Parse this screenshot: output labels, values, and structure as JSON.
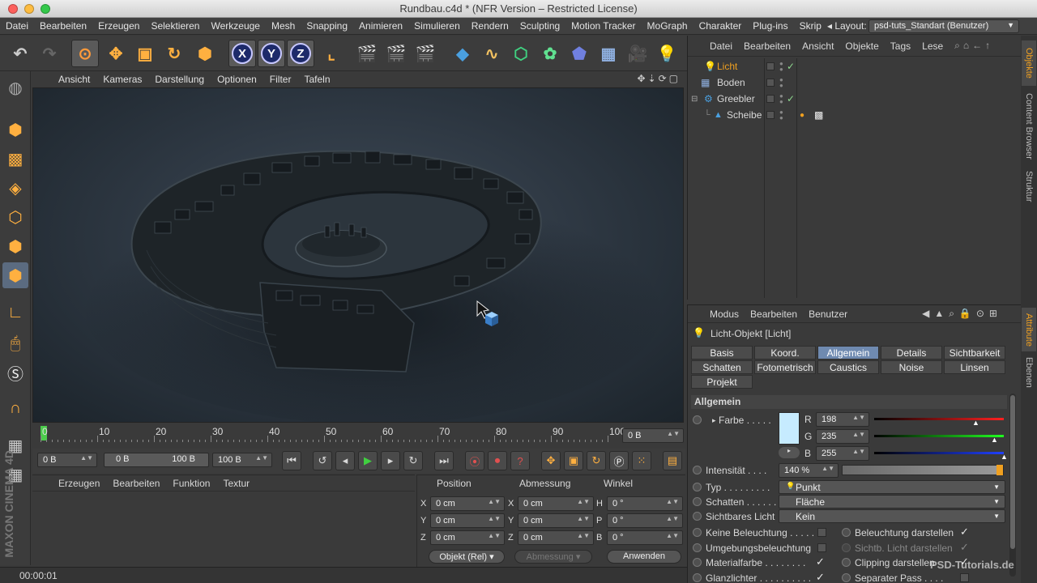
{
  "window": {
    "title": "Rundbau.c4d * (NFR Version – Restricted License)"
  },
  "menubar": {
    "items": [
      "Datei",
      "Bearbeiten",
      "Erzeugen",
      "Selektieren",
      "Werkzeuge",
      "Mesh",
      "Snapping",
      "Animieren",
      "Simulieren",
      "Rendern",
      "Sculpting",
      "Motion Tracker",
      "MoGraph",
      "Charakter",
      "Plug-ins",
      "Skrip"
    ],
    "layout_label": "Layout:",
    "layout_value": "psd-tuts_Standart (Benutzer)"
  },
  "toolbar": {
    "axis_x": "X",
    "axis_y": "Y",
    "axis_z": "Z"
  },
  "viewport": {
    "menu": [
      "Ansicht",
      "Kameras",
      "Darstellung",
      "Optionen",
      "Filter",
      "Tafeln"
    ]
  },
  "timeline": {
    "ticks": [
      "0",
      "10",
      "20",
      "30",
      "40",
      "50",
      "60",
      "70",
      "80",
      "90",
      "100"
    ],
    "current_frame": "0 B",
    "start_field": "0 B",
    "min_field": "0 B",
    "max_field": "100 B",
    "end_field": "100 B"
  },
  "material_manager": {
    "menu": [
      "Erzeugen",
      "Bearbeiten",
      "Funktion",
      "Textur"
    ]
  },
  "coordinates": {
    "headers": [
      "Position",
      "Abmessung",
      "Winkel"
    ],
    "rows": [
      {
        "pos_axis": "X",
        "pos": "0 cm",
        "size_axis": "X",
        "size": "0 cm",
        "rot_axis": "H",
        "rot": "0 °"
      },
      {
        "pos_axis": "Y",
        "pos": "0 cm",
        "size_axis": "Y",
        "size": "0 cm",
        "rot_axis": "P",
        "rot": "0 °"
      },
      {
        "pos_axis": "Z",
        "pos": "0 cm",
        "size_axis": "Z",
        "size": "0 cm",
        "rot_axis": "B",
        "rot": "0 °"
      }
    ],
    "mode_dropdown": "Objekt (Rel)",
    "size_dropdown": "Abmessung",
    "apply_button": "Anwenden"
  },
  "status": {
    "time": "00:00:01"
  },
  "object_manager": {
    "menu": [
      "Datei",
      "Bearbeiten",
      "Ansicht",
      "Objekte",
      "Tags",
      "Lese"
    ],
    "objects": [
      {
        "name": "Licht",
        "highlight": true,
        "checked": true
      },
      {
        "name": "Boden",
        "highlight": false,
        "checked": false
      },
      {
        "name": "Greebler",
        "highlight": false,
        "checked": true
      },
      {
        "name": "Scheibe",
        "highlight": false,
        "checked": false
      }
    ]
  },
  "side_tabs": {
    "top": [
      "Objekte",
      "Content Browser",
      "Struktur"
    ],
    "bottom": [
      "Attribute",
      "Ebenen"
    ]
  },
  "attribute_manager": {
    "menu": [
      "Modus",
      "Bearbeiten",
      "Benutzer"
    ],
    "title": "Licht-Objekt [Licht]",
    "tabs_row1": [
      "Basis",
      "Koord.",
      "Allgemein",
      "Details",
      "Sichtbarkeit"
    ],
    "tabs_row2": [
      "Schatten",
      "Fotometrisch",
      "Caustics",
      "Noise",
      "Linsen"
    ],
    "tabs_row3": [
      "Projekt"
    ],
    "section": "Allgemein",
    "farbe_label": "Farbe",
    "r_label": "R",
    "r_value": "198",
    "g_label": "G",
    "g_value": "235",
    "b_label": "B",
    "b_value": "255",
    "color_swatch": "#c6ebff",
    "intensity_label": "Intensität",
    "intensity_value": "140 %",
    "typ_label": "Typ",
    "typ_value": "Punkt",
    "schatten_label": "Schatten",
    "schatten_value": "Fläche",
    "sichtbares_label": "Sichtbares Licht",
    "sichtbares_value": "Kein",
    "keine_beleuchtung": "Keine Beleuchtung",
    "beleuchtung_darstellen": "Beleuchtung darstellen",
    "umgebungsbeleuchtung": "Umgebungsbeleuchtung",
    "sichtb_licht_darstellen": "Sichtb. Licht darstellen",
    "materialfarbe": "Materialfarbe",
    "clipping_darstellen": "Clipping darstellen",
    "glanzlichter": "Glanzlichter",
    "separater_pass": "Separater Pass"
  },
  "watermark": "PSD-Tutorials.de"
}
